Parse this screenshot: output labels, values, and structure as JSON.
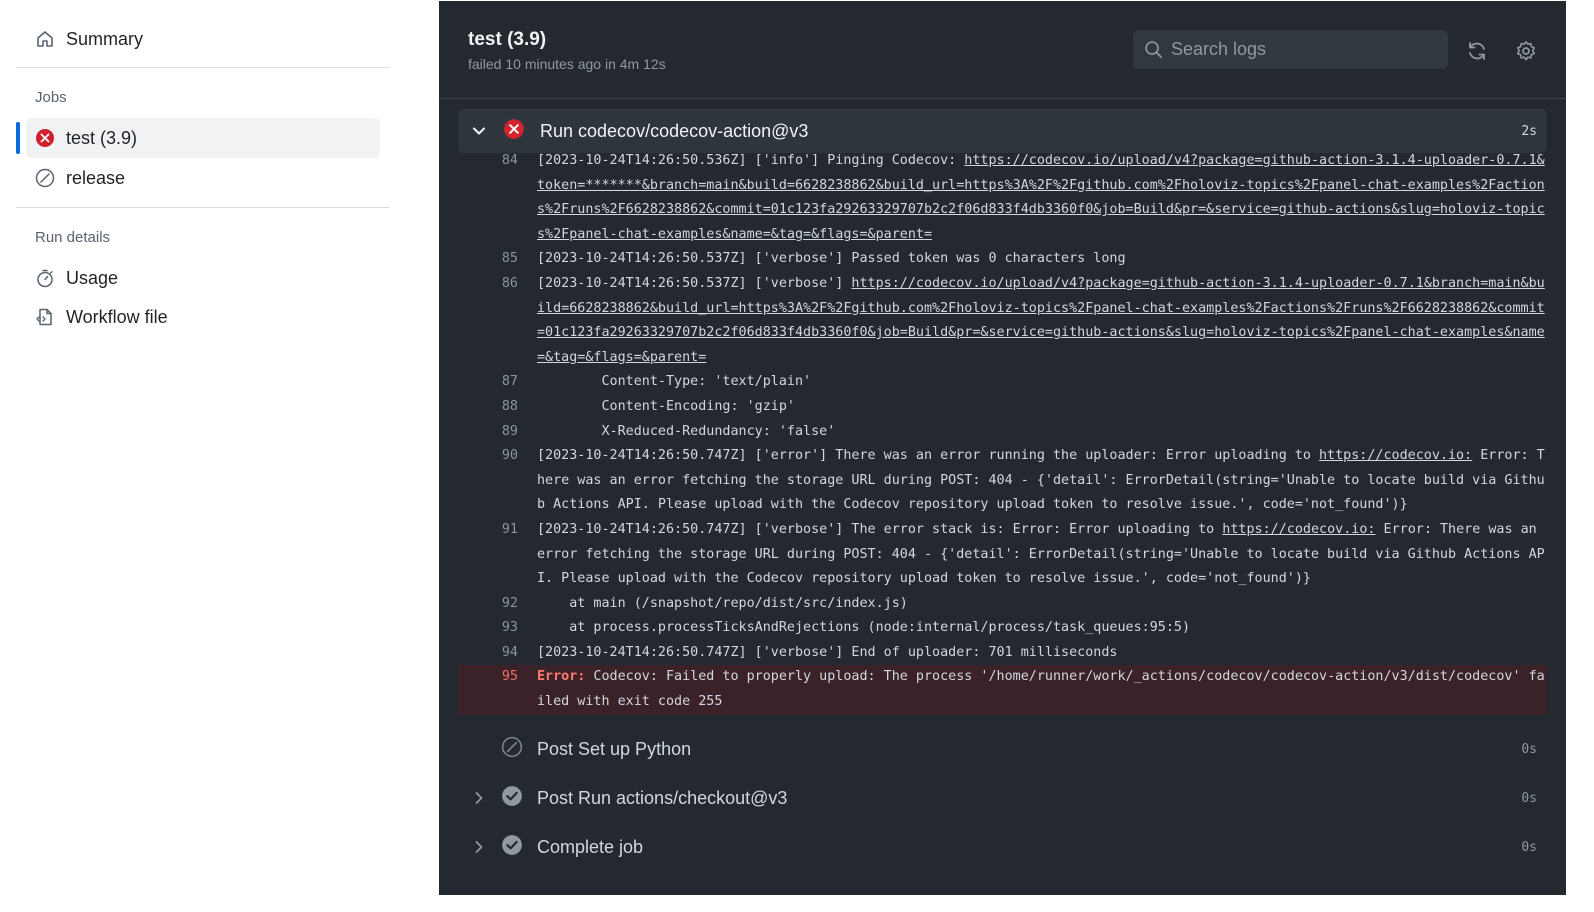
{
  "sidebar": {
    "summary_label": "Summary",
    "jobs_heading": "Jobs",
    "jobs": [
      {
        "label": "test (3.9)",
        "status": "failed",
        "icon": "x-circle-icon"
      },
      {
        "label": "release",
        "status": "skipped",
        "icon": "skipped-icon"
      }
    ],
    "run_details_heading": "Run details",
    "details": [
      {
        "label": "Usage",
        "icon": "stopwatch-icon"
      },
      {
        "label": "Workflow file",
        "icon": "file-code-icon"
      }
    ]
  },
  "header": {
    "title": "test (3.9)",
    "subtitle": "failed 10 minutes ago in 4m 12s",
    "search_placeholder": "Search logs"
  },
  "current_step": {
    "name": "Run codecov/codecov-action@v3",
    "duration": "2s",
    "status": "failed"
  },
  "log": [
    {
      "num": "84",
      "text": "[2023-10-24T14:26:50.536Z] ['info'] Pinging Codecov: ",
      "link": "https://codecov.io/upload/v4?package=github-action-3.1.4-uploader-0.7.1&token=*******&branch=main&build=6628238862&build_url=https%3A%2F%2Fgithub.com%2Fholoviz-topics%2Fpanel-chat-examples%2Factions%2Fruns%2F6628238862&commit=01c123fa29263329707b2c2f06d833f4db3360f0&job=Build&pr=&service=github-actions&slug=holoviz-topics%2Fpanel-chat-examples&name=&tag=&flags=&parent=",
      "after": ""
    },
    {
      "num": "85",
      "text": "[2023-10-24T14:26:50.537Z] ['verbose'] Passed token was 0 characters long",
      "link": "",
      "after": ""
    },
    {
      "num": "86",
      "text": "[2023-10-24T14:26:50.537Z] ['verbose'] ",
      "link": "https://codecov.io/upload/v4?package=github-action-3.1.4-uploader-0.7.1&branch=main&build=6628238862&build_url=https%3A%2F%2Fgithub.com%2Fholoviz-topics%2Fpanel-chat-examples%2Factions%2Fruns%2F6628238862&commit=01c123fa29263329707b2c2f06d833f4db3360f0&job=Build&pr=&service=github-actions&slug=holoviz-topics%2Fpanel-chat-examples&name=&tag=&flags=&parent=",
      "after": ""
    },
    {
      "num": "87",
      "text": "        Content-Type: 'text/plain'",
      "link": "",
      "after": ""
    },
    {
      "num": "88",
      "text": "        Content-Encoding: 'gzip'",
      "link": "",
      "after": ""
    },
    {
      "num": "89",
      "text": "        X-Reduced-Redundancy: 'false'",
      "link": "",
      "after": ""
    },
    {
      "num": "90",
      "text": "[2023-10-24T14:26:50.747Z] ['error'] There was an error running the uploader: Error uploading to ",
      "link": "https://codecov.io:",
      "after": " Error: There was an error fetching the storage URL during POST: 404 - {'detail': ErrorDetail(string='Unable to locate build via Github Actions API. Please upload with the Codecov repository upload token to resolve issue.', code='not_found')}"
    },
    {
      "num": "91",
      "text": "[2023-10-24T14:26:50.747Z] ['verbose'] The error stack is: Error: Error uploading to ",
      "link": "https://codecov.io:",
      "after": " Error: There was an error fetching the storage URL during POST: 404 - {'detail': ErrorDetail(string='Unable to locate build via Github Actions API. Please upload with the Codecov repository upload token to resolve issue.', code='not_found')}"
    },
    {
      "num": "92",
      "text": "    at main (/snapshot/repo/dist/src/index.js)",
      "link": "",
      "after": ""
    },
    {
      "num": "93",
      "text": "    at process.processTicksAndRejections (node:internal/process/task_queues:95:5)",
      "link": "",
      "after": ""
    },
    {
      "num": "94",
      "text": "[2023-10-24T14:26:50.747Z] ['verbose'] End of uploader: 701 milliseconds",
      "link": "",
      "after": ""
    }
  ],
  "error_line": {
    "num": "95",
    "keyword": "Error:",
    "text": " Codecov: Failed to properly upload: The process '/home/runner/work/_actions/codecov/codecov-action/v3/dist/codecov' failed with exit code 255"
  },
  "steps": [
    {
      "name": "Post Set up Python",
      "duration": "0s",
      "status": "skipped"
    },
    {
      "name": "Post Run actions/checkout@v3",
      "duration": "0s",
      "status": "success"
    },
    {
      "name": "Complete job",
      "duration": "0s",
      "status": "success"
    }
  ],
  "colors": {
    "failed": "#cf222e",
    "active_bar": "#0969da",
    "panel_bg": "#24292f",
    "error_line_bg": "#3b2228"
  }
}
